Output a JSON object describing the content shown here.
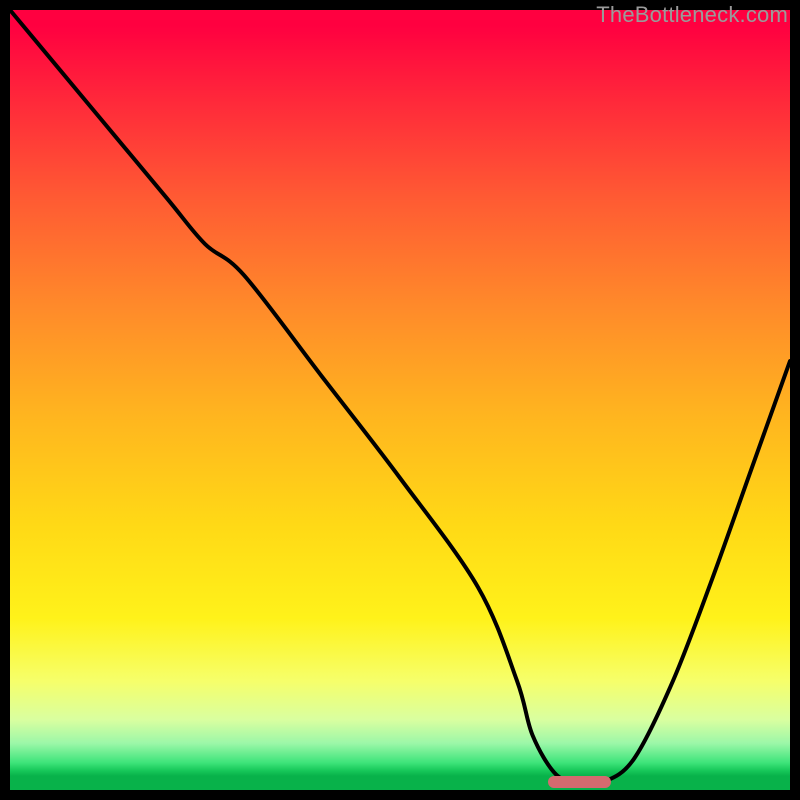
{
  "watermark": "TheBottleneck.com",
  "colors": {
    "background": "#000000",
    "gradient_top": "#ff0040",
    "gradient_mid": "#ffd916",
    "gradient_bottom": "#08b24a",
    "curve": "#000000",
    "marker": "#d46a6f"
  },
  "chart_data": {
    "type": "line",
    "title": "",
    "xlabel": "",
    "ylabel": "",
    "xlim": [
      0,
      100
    ],
    "ylim": [
      0,
      100
    ],
    "grid": false,
    "legend": false,
    "series": [
      {
        "name": "bottleneck-curve",
        "x": [
          0,
          10,
          20,
          25,
          30,
          40,
          50,
          60,
          65,
          67,
          70,
          73,
          76,
          80,
          85,
          90,
          95,
          100
        ],
        "y": [
          100,
          88,
          76,
          70,
          66,
          53,
          40,
          26,
          14,
          7,
          2,
          1,
          1,
          4,
          14,
          27,
          41,
          55
        ]
      }
    ],
    "marker": {
      "name": "optimal-range",
      "x_start": 69,
      "x_end": 77,
      "y": 1
    },
    "background_gradient_stops": [
      {
        "pos": 0,
        "color": "#ff0040"
      },
      {
        "pos": 0.38,
        "color": "#ff8a2a"
      },
      {
        "pos": 0.66,
        "color": "#ffd916"
      },
      {
        "pos": 0.86,
        "color": "#f6ff6a"
      },
      {
        "pos": 0.97,
        "color": "#17c85a"
      },
      {
        "pos": 1.0,
        "color": "#08b24a"
      }
    ]
  }
}
